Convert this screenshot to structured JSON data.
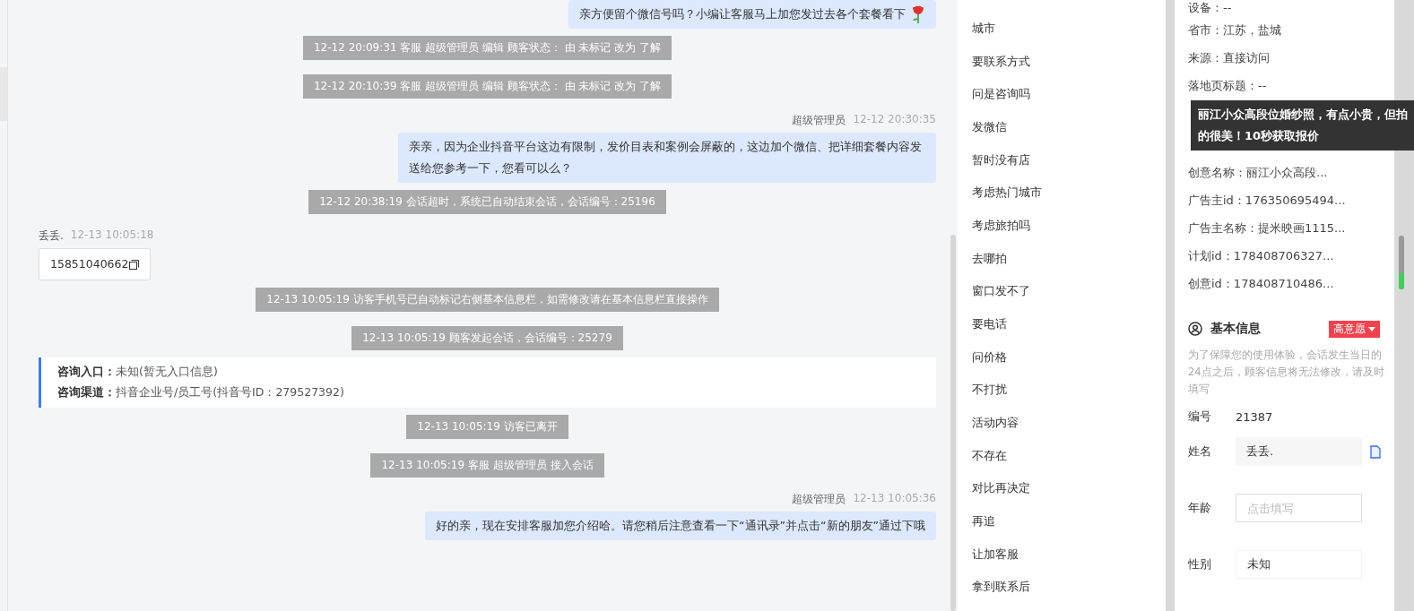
{
  "chat": [
    {
      "kind": "agent",
      "text": "亲方便留个微信号吗？小编让客服马上加您发过去各个套餐看下"
    },
    {
      "kind": "system",
      "text": "12-12 20:09:31 客服 超级管理员 编辑 顾客状态： 由 未标记 改为 了解"
    },
    {
      "kind": "system",
      "text": "12-12 20:10:39 客服 超级管理员 编辑 顾客状态： 由 未标记 改为 了解"
    },
    {
      "kind": "agent",
      "name": "超级管理员",
      "time": "12-12 20:30:35",
      "text": "亲亲，因为企业抖音平台这边有限制，发价目表和案例会屏蔽的，这边加个微信、把详细套餐内容发送给您参考一下，您看可以么？"
    },
    {
      "kind": "system",
      "text": "12-12 20:38:19 会话超时，系统已自动结束会话，会话编号：25196"
    },
    {
      "kind": "visitor",
      "name": "丢丢.",
      "time": "12-13 10:05:18",
      "text": "15851040662"
    },
    {
      "kind": "system",
      "text": "12-13 10:05:19 访客手机号已自动标记右侧基本信息栏，如需修改请在基本信息栏直接操作"
    },
    {
      "kind": "system",
      "text": "12-13 10:05:19 顾客发起会话，会话编号：25279"
    },
    {
      "kind": "info",
      "lines": [
        {
          "label": "咨询入口：",
          "value": "未知(暂无入口信息)"
        },
        {
          "label": "咨询渠道：",
          "value": "抖音企业号/员工号(抖音号ID：279527392)"
        }
      ]
    },
    {
      "kind": "system",
      "text": "12-13 10:05:19 访客已离开"
    },
    {
      "kind": "system",
      "text": "12-13 10:05:19 客服 超级管理员 接入会话"
    },
    {
      "kind": "agent",
      "name": "超级管理员",
      "time": "12-13 10:05:36",
      "text": "好的亲，现在安排客服加您介绍哈。请您稍后注意查看一下“通讯录”并点击“新的朋友”通过下哦"
    }
  ],
  "quick_replies": [
    "城市",
    "要联系方式",
    "问是咨询吗",
    "发微信",
    "暂时没有店",
    "考虑热门城市",
    "考虑旅拍吗",
    "去哪拍",
    "窗口发不了",
    "要电话",
    "问价格",
    "不打扰",
    "活动内容",
    "不存在",
    "对比再决定",
    "再追",
    "让加客服",
    "拿到联系后"
  ],
  "source_info": {
    "before_tooltip": [
      "设备：--",
      "省市：江苏，盐城",
      "来源：直接访问",
      "落地页标题：--"
    ],
    "tooltip": "丽江小众高段位婚纱照，有点小贵，但拍的很美！10秒获取报价",
    "after_tooltip": [
      "创意名称：丽江小众高段...",
      "广告主id：176350695494...",
      "广告主名称：提米映画1115...",
      "计划id：178408706327...",
      "创意id：178408710486..."
    ]
  },
  "basic_info": {
    "title": "基本信息",
    "intent_tag": "高意愿",
    "note": "为了保障您的使用体验，会话发生当日的24点之后，顾客信息将无法修改，请及时填写",
    "fields": [
      {
        "kind": "text",
        "label": "编号",
        "value": "21387"
      },
      {
        "kind": "readonly",
        "label": "姓名",
        "value": "丢丢."
      },
      {
        "kind": "input",
        "label": "年龄",
        "placeholder": "点击填写"
      },
      {
        "kind": "select",
        "label": "性别",
        "value": "未知"
      }
    ]
  }
}
